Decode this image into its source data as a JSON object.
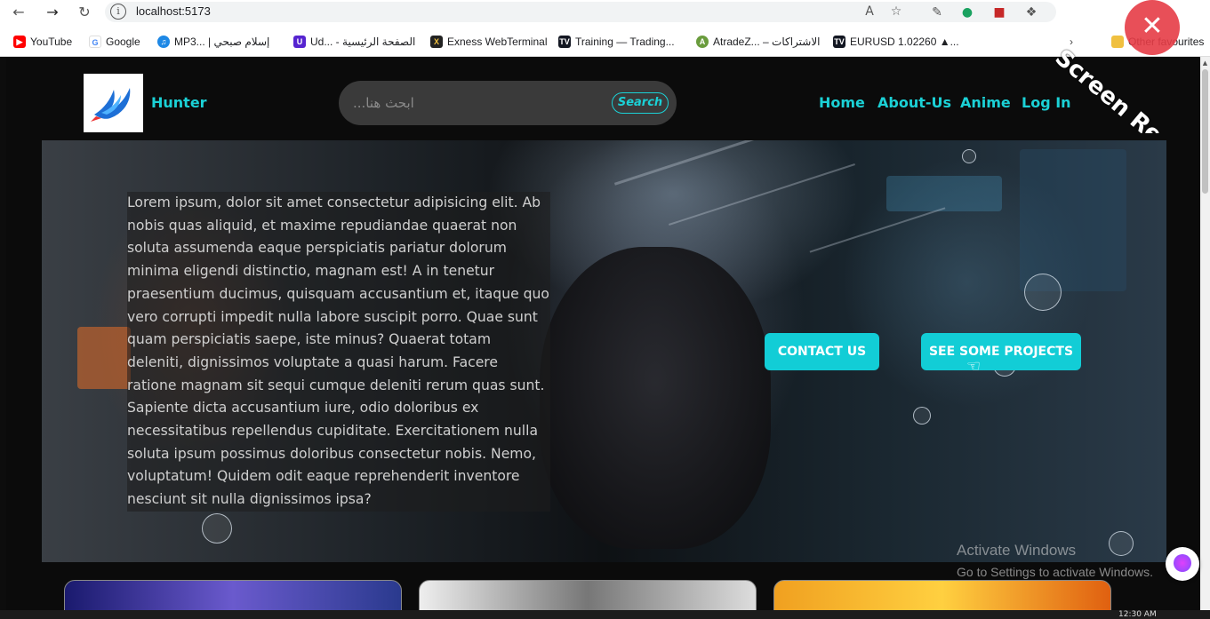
{
  "browser": {
    "url": "localhost:5173",
    "bookmarks": [
      {
        "label": "YouTube",
        "icon": "youtube-icon",
        "color": "#ff0000"
      },
      {
        "label": "Google",
        "icon": "google-icon",
        "color": "#4285f4"
      },
      {
        "label": "MP3... | إسلام صبحي",
        "icon": "mp3-icon",
        "color": "#1e88e5"
      },
      {
        "label": "Ud... - الصفحة الرئيسية",
        "icon": "udemy-icon",
        "color": "#5624d0"
      },
      {
        "label": "Exness WebTerminal",
        "icon": "exness-icon",
        "color": "#222222"
      },
      {
        "label": "Training — Trading...",
        "icon": "tradingview-icon",
        "color": "#131722"
      },
      {
        "label": "AtradeZ... – الاشتراكات",
        "icon": "atradez-icon",
        "color": "#6a9c3d"
      },
      {
        "label": "EURUSD 1.02260 ▲...",
        "icon": "tradingview-icon",
        "color": "#131722"
      },
      {
        "label": "Other favourites",
        "icon": "folder-icon",
        "color": "#f0c040"
      }
    ]
  },
  "header": {
    "brand": "Hunter",
    "search_placeholder": "ابحث هنا...",
    "search_button": "Search",
    "nav": [
      "Home",
      "About-Us",
      "Anime",
      "Log In"
    ]
  },
  "hero": {
    "text": "Lorem ipsum, dolor sit amet consectetur adipisicing elit. Ab nobis quas aliquid, et maxime repudiandae quaerat non soluta assumenda eaque perspiciatis pariatur dolorum minima eligendi distinctio, magnam est! A in tenetur praesentium ducimus, quisquam accusantium et, itaque quo vero corrupti impedit nulla labore suscipit porro. Quae sunt quam perspiciatis saepe, iste minus? Quaerat totam deleniti, dignissimos voluptate a quasi harum. Facere ratione magnam sit sequi cumque deleniti rerum quas sunt. Sapiente dicta accusantium iure, odio doloribus ex necessitatibus repellendus cupiditate. Exercitationem nulla soluta ipsum possimus doloribus consectetur nobis. Nemo, voluptatum! Quidem odit eaque reprehenderit inventore nesciunt sit nulla dignissimos ipsa?",
    "contact_button": "CONTACT US",
    "projects_button": "SEE SOME PROJECTS"
  },
  "overlay": {
    "activate_title": "Activate Windows",
    "activate_subtitle": "Go to Settings to activate Windows.",
    "recorder_label": "Screen Recorder",
    "taskbar_time": "12:30 AM"
  },
  "colors": {
    "accent": "#1bd1d6",
    "button_bg": "#12cdd6",
    "page_bg": "#0b0b0b"
  }
}
